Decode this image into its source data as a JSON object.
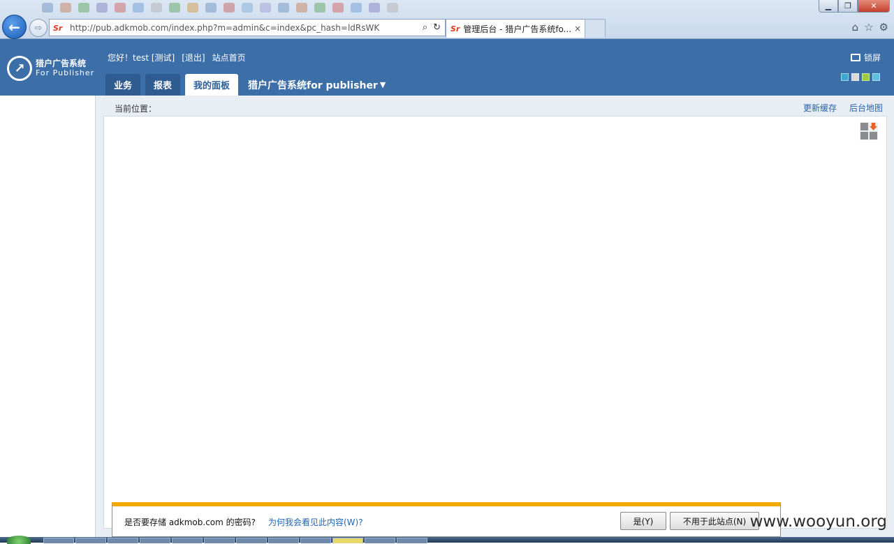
{
  "browser": {
    "url": "http://pub.adkmob.com/index.php?m=admin&c=index&pc_hash=ldRsWK",
    "tab_title": "管理后台 - 猎户广告系统fo...",
    "tab_close": "×",
    "back_glyph": "←",
    "forward_glyph": "⇨",
    "window_buttons": {
      "minimize": "▁",
      "maximize": "❐",
      "close": "✕"
    }
  },
  "header": {
    "logo_line1": "猎户广告系统",
    "logo_line2": "For Publisher",
    "greeting": "您好！test [测试]",
    "logout": "[退出]",
    "site_home": "站点首页",
    "lock_screen": "锁屏",
    "theme_swatches": [
      "#3fa7d6",
      "#d9d9d9",
      "#9ccc3a",
      "#5bc0de"
    ]
  },
  "tabs": [
    {
      "label": "业务",
      "active": false
    },
    {
      "label": "报表",
      "active": false
    },
    {
      "label": "我的面板",
      "active": true
    }
  ],
  "system_menu": {
    "label": "猎户广告系统for publisher",
    "caret": "▼"
  },
  "content": {
    "breadcrumb_label": "当前位置：",
    "refresh_cache": "更新缓存",
    "admin_map": "后台地图"
  },
  "notification_bar": {
    "message": "是否要存储 adkmob.com 的密码?",
    "why_link": "为何我会看见此内容(W)?",
    "yes_button": "是(Y)",
    "not_for_site_button": "不用于此站点(N)",
    "accent_color": "#f2a900"
  },
  "watermark": "www.wooyun.org",
  "colors": {
    "header_bg": "#3c6ea8",
    "tab_bg": "#2e5b90",
    "link": "#2a64a8"
  }
}
